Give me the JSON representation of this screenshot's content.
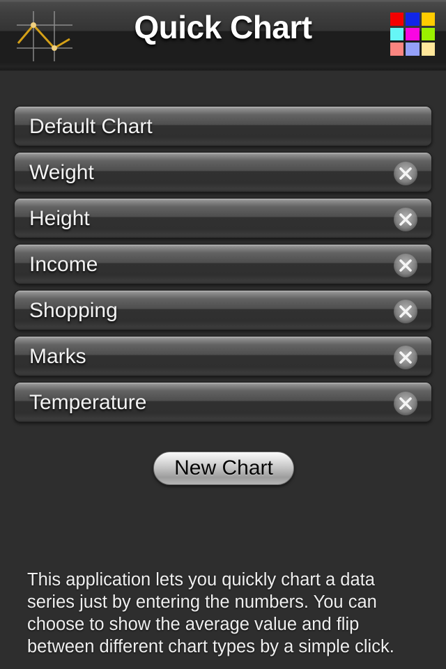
{
  "app": {
    "title": "Quick Chart",
    "background_color": "#2e2e2e"
  },
  "header": {
    "title": "Quick Chart",
    "logo_icon": "line-chart-icon",
    "logo_line_color": "#d4a017",
    "logo_grid_color": "#9a9a9a",
    "palette_icon": "color-palette-grid-icon",
    "palette_colors": [
      "#f40000",
      "#1026e8",
      "#ffcc00",
      "#66f6f6",
      "#f906e2",
      "#9bf000",
      "#fa8580",
      "#94a0f8",
      "#ffe79a"
    ]
  },
  "list": {
    "items": [
      {
        "label": "Default Chart",
        "deletable": false,
        "delete_icon": "close-circle-icon"
      },
      {
        "label": "Weight",
        "deletable": true,
        "delete_icon": "close-circle-icon"
      },
      {
        "label": "Height",
        "deletable": true,
        "delete_icon": "close-circle-icon"
      },
      {
        "label": "Income",
        "deletable": true,
        "delete_icon": "close-circle-icon"
      },
      {
        "label": "Shopping",
        "deletable": true,
        "delete_icon": "close-circle-icon"
      },
      {
        "label": "Marks",
        "deletable": true,
        "delete_icon": "close-circle-icon"
      },
      {
        "label": "Temperature",
        "deletable": true,
        "delete_icon": "close-circle-icon"
      }
    ]
  },
  "actions": {
    "new_chart_label": "New Chart"
  },
  "footer": {
    "description": "This application lets you quickly chart a data series just by entering the numbers. You can choose to show the average value and flip between different chart types by a simple click."
  }
}
